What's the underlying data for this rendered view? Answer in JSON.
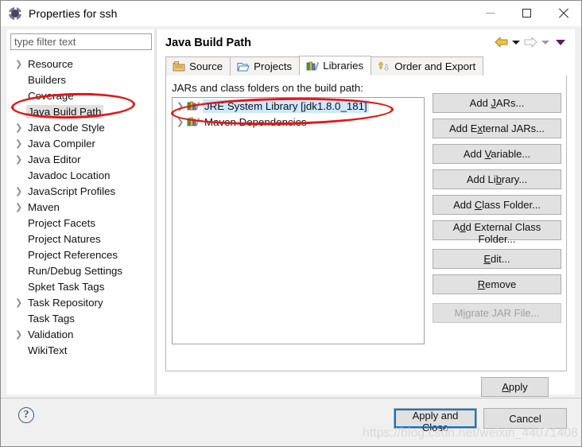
{
  "window": {
    "title": "Properties for ssh",
    "icon": "gear-icon",
    "controls": {
      "minimize": "minimize-icon",
      "maximize": "maximize-icon",
      "close": "close-icon"
    }
  },
  "sidebar": {
    "filter": {
      "value": "",
      "placeholder": "type filter text"
    },
    "items": [
      {
        "label": "Resource",
        "expandable": true,
        "selected": false
      },
      {
        "label": "Builders",
        "expandable": false,
        "selected": false
      },
      {
        "label": "Coverage",
        "expandable": false,
        "selected": false
      },
      {
        "label": "Java Build Path",
        "expandable": false,
        "selected": true
      },
      {
        "label": "Java Code Style",
        "expandable": true,
        "selected": false
      },
      {
        "label": "Java Compiler",
        "expandable": true,
        "selected": false
      },
      {
        "label": "Java Editor",
        "expandable": true,
        "selected": false
      },
      {
        "label": "Javadoc Location",
        "expandable": false,
        "selected": false
      },
      {
        "label": "JavaScript Profiles",
        "expandable": true,
        "selected": false
      },
      {
        "label": "Maven",
        "expandable": true,
        "selected": false
      },
      {
        "label": "Project Facets",
        "expandable": false,
        "selected": false
      },
      {
        "label": "Project Natures",
        "expandable": false,
        "selected": false
      },
      {
        "label": "Project References",
        "expandable": false,
        "selected": false
      },
      {
        "label": "Run/Debug Settings",
        "expandable": false,
        "selected": false
      },
      {
        "label": "Spket Task Tags",
        "expandable": false,
        "selected": false
      },
      {
        "label": "Task Repository",
        "expandable": true,
        "selected": false
      },
      {
        "label": "Task Tags",
        "expandable": false,
        "selected": false
      },
      {
        "label": "Validation",
        "expandable": true,
        "selected": false
      },
      {
        "label": "WikiText",
        "expandable": false,
        "selected": false
      }
    ]
  },
  "main": {
    "page_title": "Java Build Path",
    "nav": {
      "back": "back-arrow-icon",
      "back_menu": "back-dropdown-icon",
      "forward": "forward-arrow-icon",
      "forward_menu": "forward-dropdown-icon",
      "view_menu": "view-menu-icon"
    },
    "tabs": [
      {
        "label": "Source",
        "icon": "source-folder-icon",
        "active": false
      },
      {
        "label": "Projects",
        "icon": "open-folder-icon",
        "active": false
      },
      {
        "label": "Libraries",
        "icon": "books-icon",
        "active": true
      },
      {
        "label": "Order and Export",
        "icon": "order-arrows-icon",
        "active": false
      }
    ],
    "list_label": "JARs and class folders on the build path:",
    "libraries": [
      {
        "label": "JRE System Library [jdk1.8.0_181]",
        "icon": "books-icon",
        "expandable": true,
        "selected": true
      },
      {
        "label": "Maven Dependencies",
        "icon": "books-icon",
        "expandable": true,
        "selected": false
      }
    ],
    "side_buttons": [
      {
        "label": "Add JARs...",
        "mnemonic": "J",
        "disabled": false,
        "gap_before": false
      },
      {
        "label": "Add External JARs...",
        "mnemonic": "x",
        "disabled": false,
        "gap_before": false
      },
      {
        "label": "Add Variable...",
        "mnemonic": "V",
        "disabled": false,
        "gap_before": false
      },
      {
        "label": "Add Library...",
        "mnemonic": "b",
        "disabled": false,
        "gap_before": false
      },
      {
        "label": "Add Class Folder...",
        "mnemonic": "C",
        "disabled": false,
        "gap_before": false
      },
      {
        "label": "Add External Class Folder...",
        "mnemonic": "d",
        "disabled": false,
        "gap_before": false
      },
      {
        "label": "Edit...",
        "mnemonic": "E",
        "disabled": false,
        "gap_before": true
      },
      {
        "label": "Remove",
        "mnemonic": "R",
        "disabled": false,
        "gap_before": false
      },
      {
        "label": "Migrate JAR File...",
        "mnemonic": "i",
        "disabled": true,
        "gap_before": true
      }
    ],
    "apply_button": {
      "label": "Apply",
      "mnemonic": "A"
    }
  },
  "footer": {
    "help_icon": "help-icon",
    "apply_and_close": "Apply and Close",
    "cancel": "Cancel"
  },
  "watermark": "https://blog.csdn.net/weixin_44071408",
  "colors": {
    "selection_blue": "#cde8ff",
    "focus_blue": "#0078d7",
    "annotation_red": "#e81414",
    "button_face": "#e1e1e1",
    "title_icon_purple": "#7d729c"
  }
}
